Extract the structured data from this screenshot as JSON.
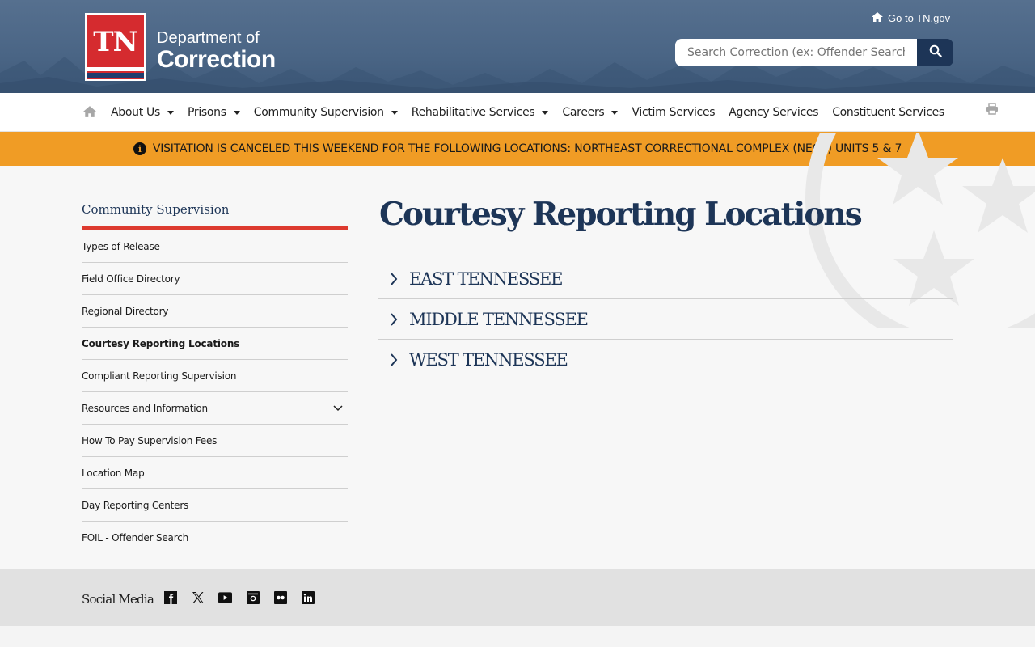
{
  "header": {
    "logo_abbrev": "TN",
    "logo_line1": "Department of",
    "logo_line2": "Correction",
    "gotn_label": "Go to TN.gov",
    "search": {
      "placeholder": "Search Correction (ex: Offender Search)"
    }
  },
  "nav": {
    "items": [
      {
        "label": "About Us",
        "dropdown": true
      },
      {
        "label": "Prisons",
        "dropdown": true
      },
      {
        "label": "Community Supervision",
        "dropdown": true
      },
      {
        "label": "Rehabilitative Services",
        "dropdown": true
      },
      {
        "label": "Careers",
        "dropdown": true
      },
      {
        "label": "Victim Services",
        "dropdown": false
      },
      {
        "label": "Agency Services",
        "dropdown": false
      },
      {
        "label": "Constituent Services",
        "dropdown": false
      }
    ]
  },
  "alert": {
    "text": "VISITATION IS CANCELED THIS WEEKEND FOR THE FOLLOWING LOCATIONS: NORTHEAST CORRECTIONAL COMPLEX (NECX) UNITS 5 & 7"
  },
  "sidebar": {
    "title": "Community Supervision",
    "items": [
      {
        "label": "Types of Release"
      },
      {
        "label": "Field Office Directory"
      },
      {
        "label": "Regional Directory"
      },
      {
        "label": "Courtesy Reporting Locations",
        "active": true
      },
      {
        "label": "Compliant Reporting Supervision"
      },
      {
        "label": "Resources and Information",
        "expandable": true
      },
      {
        "label": "How To Pay Supervision Fees"
      },
      {
        "label": "Location Map"
      },
      {
        "label": "Day Reporting Centers"
      },
      {
        "label": "FOIL - Offender Search"
      }
    ]
  },
  "main": {
    "title": "Courtesy Reporting Locations",
    "sections": [
      {
        "label": "EAST TENNESSEE"
      },
      {
        "label": "MIDDLE TENNESSEE"
      },
      {
        "label": "WEST TENNESSEE"
      }
    ]
  },
  "footer": {
    "social_label": "Social Media",
    "social_icons": [
      "facebook-icon",
      "x-twitter-icon",
      "youtube-icon",
      "instagram-icon",
      "flickr-icon",
      "linkedin-icon"
    ]
  },
  "colors": {
    "navy": "#1d3557",
    "alert": "#f09c25",
    "accent_red": "#dd3a2f",
    "header_blue": "#4a6585"
  }
}
